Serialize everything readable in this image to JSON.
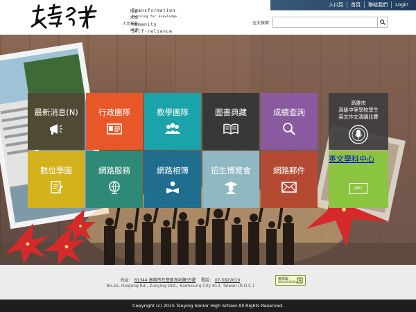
{
  "header": {
    "nav": [
      "入口頁",
      "首頁",
      "聯絡我們",
      "Login"
    ],
    "motto_zh": [
      "悅變",
      "求知",
      "人文素養",
      "自律"
    ],
    "motto_en": [
      "Transformation",
      "Yearning for knowledge",
      "Humanity",
      "Self-reliance"
    ],
    "search": {
      "label": "全文檢索",
      "placeholder": "",
      "icon": "search-icon"
    }
  },
  "tiles": [
    {
      "label": "最新消息(N)",
      "color": "#4f4a33",
      "icon": "megaphone-icon"
    },
    {
      "label": "行政團隊",
      "color": "#e8572a",
      "icon": "id-card-icon"
    },
    {
      "label": "教學團隊",
      "color": "#1aa3a8",
      "icon": "group-icon"
    },
    {
      "label": "圖書典藏",
      "color": "#383838",
      "icon": "open-book-icon"
    },
    {
      "label": "成績查詢",
      "color": "#8a5aa0",
      "icon": "magnifier-icon"
    },
    {
      "label": "數位學園",
      "color": "#d4b21e",
      "icon": "notepad-icon"
    },
    {
      "label": "網路服務",
      "color": "#2e8a76",
      "icon": "globe-icon"
    },
    {
      "label": "網路相簿",
      "color": "#1f6d8f",
      "icon": "reader-icon"
    },
    {
      "label": "招生博覽會",
      "color": "#8fb8c2",
      "icon": "graduate-icon"
    },
    {
      "label": "網路郵件",
      "color": "#b54a32",
      "icon": "envelope-icon"
    }
  ],
  "side_banner": {
    "lines": [
      "高雄市",
      "高級中等學校學生",
      "英文作文演講比賽"
    ],
    "icon": "speech-contest-emblem-icon"
  },
  "side_tile": {
    "label": "英文學科中心",
    "icon": "abc-keyboard-icon",
    "icon_text": "ABC"
  },
  "footer": {
    "address_label": "校址：",
    "address_zh": "81344 高雄市左營區海功路55號",
    "phone_label": "電話：",
    "phone": "07-5822010",
    "address_en": "No.55, Haigong Rd., Zuoying Dist., Kaohsiung City 813, Taiwan (R.O.C.)",
    "badge_line1": "無障礙",
    "badge_line2": "Accessibility",
    "copyright": "Copyright (c) 2015 Tsoying Senior High School All Rights Reserved."
  },
  "colors": {
    "accent": "#1f3b59",
    "footer_bar": "#1e1e1e"
  }
}
